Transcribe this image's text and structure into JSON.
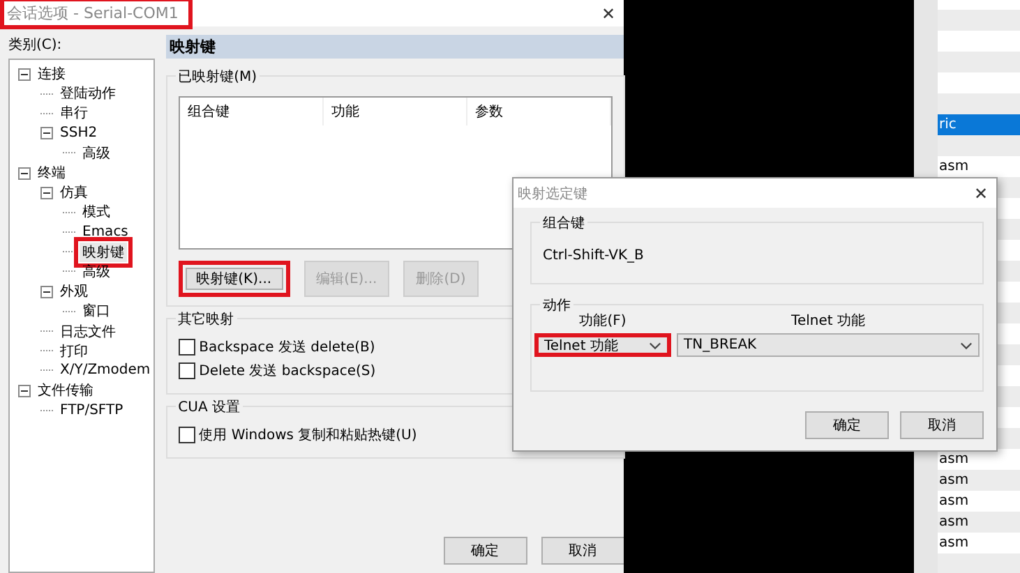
{
  "window": {
    "title": "会话选项 - Serial-COM1",
    "highlighted": true,
    "close": "✕"
  },
  "category_label": "类别(C):",
  "tree": [
    {
      "label": "连接",
      "expanded": true,
      "selected": false,
      "highlighted": false,
      "children": [
        {
          "label": "登陆动作",
          "selected": false,
          "highlighted": false
        },
        {
          "label": "串行",
          "selected": false,
          "highlighted": false
        },
        {
          "label": "SSH2",
          "expanded": true,
          "selected": false,
          "highlighted": false,
          "children": [
            {
              "label": "高级",
              "selected": false,
              "highlighted": false
            }
          ]
        }
      ]
    },
    {
      "label": "终端",
      "expanded": true,
      "selected": false,
      "highlighted": false,
      "children": [
        {
          "label": "仿真",
          "expanded": true,
          "selected": false,
          "highlighted": false,
          "children": [
            {
              "label": "模式",
              "selected": false,
              "highlighted": false
            },
            {
              "label": "Emacs",
              "selected": false,
              "highlighted": false
            },
            {
              "label": "映射键",
              "selected": true,
              "highlighted": true
            },
            {
              "label": "高级",
              "selected": false,
              "highlighted": false
            }
          ]
        },
        {
          "label": "外观",
          "expanded": true,
          "selected": false,
          "highlighted": false,
          "children": [
            {
              "label": "窗口",
              "selected": false,
              "highlighted": false
            }
          ]
        },
        {
          "label": "日志文件",
          "selected": false,
          "highlighted": false
        },
        {
          "label": "打印",
          "selected": false,
          "highlighted": false
        },
        {
          "label": "X/Y/Zmodem",
          "selected": false,
          "highlighted": false
        }
      ]
    },
    {
      "label": "文件传输",
      "expanded": true,
      "selected": false,
      "highlighted": false,
      "children": [
        {
          "label": "FTP/SFTP",
          "selected": false,
          "highlighted": false
        }
      ]
    }
  ],
  "panel": {
    "heading": "映射键",
    "mapped_group": {
      "label": "已映射键(M)",
      "columns": [
        "组合键",
        "功能",
        "参数"
      ],
      "buttons": [
        {
          "label": "映射键(K)...",
          "disabled": false,
          "highlighted": true
        },
        {
          "label": "编辑(E)...",
          "disabled": true,
          "highlighted": false
        },
        {
          "label": "删除(D)",
          "disabled": true,
          "highlighted": false
        }
      ]
    },
    "other_group": {
      "label": "其它映射",
      "options": [
        {
          "label": "Backspace 发送 delete(B)",
          "checked": false
        },
        {
          "label": "Delete 发送 backspace(S)",
          "checked": false
        }
      ]
    },
    "cua_group": {
      "label": "CUA 设置",
      "options": [
        {
          "label": "使用 Windows 复制和粘贴热键(U)",
          "checked": false
        }
      ]
    }
  },
  "footer_buttons": [
    "确定",
    "取消"
  ],
  "sub_dialog": {
    "title": "映射选定键",
    "close": "✕",
    "key_group": {
      "label": "组合键",
      "value": "Ctrl-Shift-VK_B"
    },
    "action_group": {
      "label": "动作",
      "function_label": "功能(F)",
      "function_value": "Telnet 功能",
      "function_highlighted": true,
      "telnet_label": "Telnet 功能",
      "telnet_value": "TN_BREAK"
    },
    "buttons": [
      "确定",
      "取消"
    ]
  },
  "side_list": {
    "rows": [
      {
        "kind": "blank"
      },
      {
        "kind": "blank"
      },
      {
        "kind": "blank"
      },
      {
        "kind": "blank"
      },
      {
        "kind": "blank"
      },
      {
        "kind": "blank"
      },
      {
        "kind": "item",
        "text": "ric",
        "selected": true
      },
      {
        "kind": "blank"
      },
      {
        "kind": "item",
        "text": "asm",
        "selected": false
      },
      {
        "kind": "blank"
      },
      {
        "kind": "blank"
      },
      {
        "kind": "blank"
      },
      {
        "kind": "blank"
      },
      {
        "kind": "blank"
      },
      {
        "kind": "blank"
      },
      {
        "kind": "blank"
      },
      {
        "kind": "blank"
      },
      {
        "kind": "blank"
      },
      {
        "kind": "blank"
      },
      {
        "kind": "blank"
      },
      {
        "kind": "blank"
      },
      {
        "kind": "blank"
      },
      {
        "kind": "item",
        "text": "asm",
        "selected": false
      },
      {
        "kind": "item",
        "text": "asm",
        "selected": false
      },
      {
        "kind": "item",
        "text": "asm",
        "selected": false
      },
      {
        "kind": "item",
        "text": "asm",
        "selected": false
      },
      {
        "kind": "item",
        "text": "asm",
        "selected": false
      },
      {
        "kind": "blank"
      }
    ]
  }
}
